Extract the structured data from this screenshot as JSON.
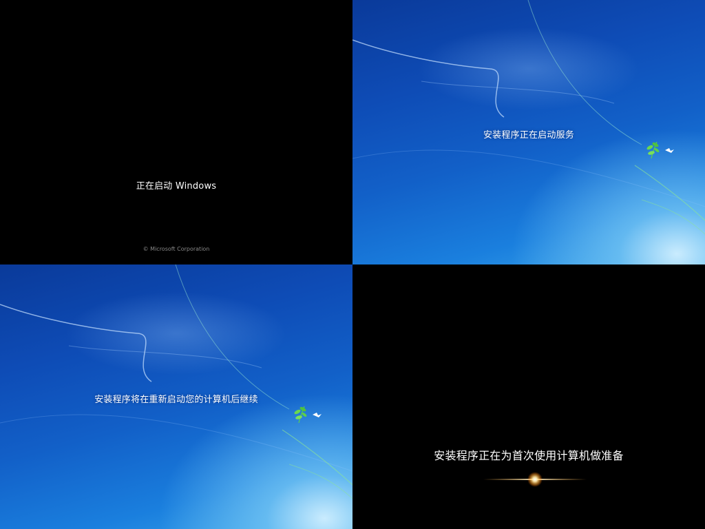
{
  "panels": {
    "starting": {
      "message": "正在启动 Windows",
      "copyright": "© Microsoft Corporation"
    },
    "setup_services": {
      "message": "安装程序正在启动服务"
    },
    "setup_restart": {
      "message": "安装程序将在重新启动您的计算机后继续"
    },
    "first_use": {
      "message": "安装程序正在为首次使用计算机做准备"
    }
  },
  "colors": {
    "black": "#000000",
    "win7_blue_dark": "#0a3a9a",
    "win7_blue_light": "#3aa6ea",
    "text": "#ffffff",
    "copyright_text": "#8a8a8a"
  },
  "icons": [
    "windows-logo-bird-icon",
    "lens-flare-icon"
  ]
}
